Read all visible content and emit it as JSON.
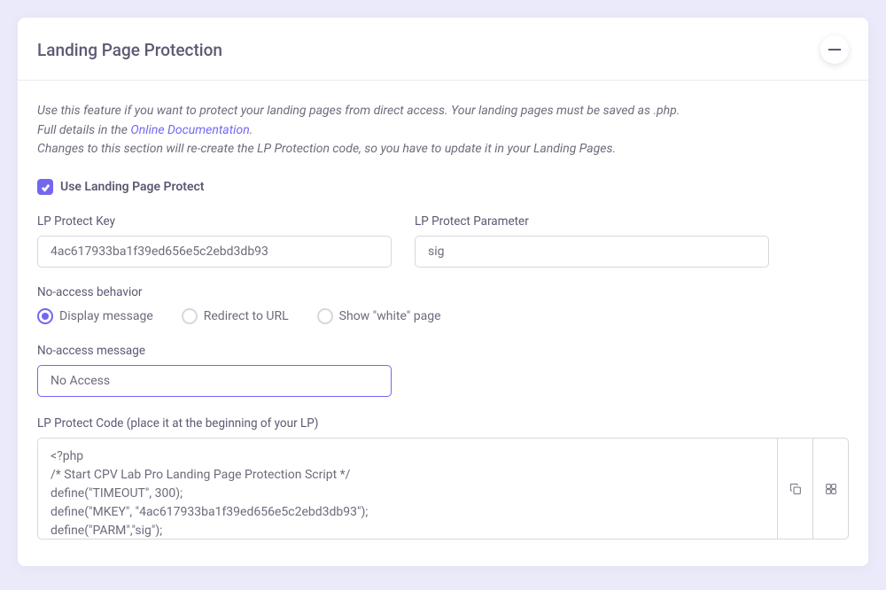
{
  "header": {
    "title": "Landing Page Protection"
  },
  "info": {
    "line1": "Use this feature if you want to protect your landing pages from direct access. Your landing pages must be saved as .php.",
    "line2a": "Full details in the ",
    "link": "Online Documentation",
    "line2b": ".",
    "line3": "Changes to this section will re-create the LP Protection code, so you have to update it in your Landing Pages."
  },
  "checkbox": {
    "label": "Use Landing Page Protect"
  },
  "fields": {
    "key": {
      "label": "LP Protect Key",
      "value": "4ac617933ba1f39ed656e5c2ebd3db93"
    },
    "param": {
      "label": "LP Protect Parameter",
      "value": "sig"
    }
  },
  "behavior": {
    "label": "No-access behavior",
    "options": {
      "display": "Display message",
      "redirect": "Redirect to URL",
      "white": "Show \"white\" page"
    }
  },
  "message": {
    "label": "No-access message",
    "value": "No Access"
  },
  "code": {
    "label": "LP Protect Code (place it at the beginning of your LP)",
    "value": "<?php\n/* Start CPV Lab Pro Landing Page Protection Script */\ndefine(\"TIMEOUT\", 300);\ndefine(\"MKEY\", \"4ac617933ba1f39ed656e5c2ebd3db93\");\ndefine(\"PARM\",\"sig\");\nfunction noaccess() { echo \"No Access\"; exit(); }\n"
  }
}
